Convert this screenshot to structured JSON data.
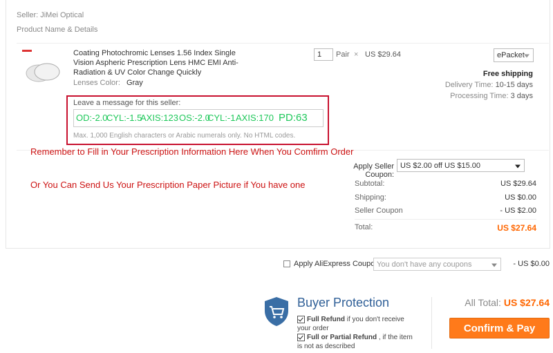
{
  "seller": {
    "label": "Seller: JiMei Optical"
  },
  "section": {
    "product_header": "Product Name & Details"
  },
  "product": {
    "title": "Coating Photochromic Lenses 1.56 Index Single Vision Aspheric Prescription Lens HMC EMI Anti-Radiation & UV Color Change Quickly",
    "lens_color_label": "Lenses Color:",
    "lens_color_value": "Gray",
    "quantity": "1",
    "unit": "Pair",
    "times": "×",
    "price": "US $29.64"
  },
  "shipping": {
    "method": "ePacket",
    "free_label": "Free shipping",
    "delivery_label": "Delivery Time:",
    "delivery_value": "10-15 days",
    "processing_label": "Processing Time:",
    "processing_value": "3 days"
  },
  "message": {
    "label": "Leave a message for this seller:",
    "od": "OD:-2.0",
    "cyl1": "CYL:-1.5",
    "axis1": "AXIS:123",
    "os": "OS:-2.0",
    "cyl2": "CYL:-1",
    "axis2": "AXIS:170",
    "pd": "PD:63",
    "hint": "Max. 1,000 English characters or Arabic numerals only. No HTML codes."
  },
  "notes": {
    "line1": "Remember to Fill in Your Prescription Information Here When You Comfirm Order",
    "line2": "Or You Can Send Us Your Prescription Paper Picture if You have one"
  },
  "coupon": {
    "label": "Apply Seller Coupon:",
    "value": "US $2.00 off US $15.00"
  },
  "summary": {
    "subtotal_label": "Subtotal:",
    "subtotal_value": "US $29.64",
    "shipping_label": "Shipping:",
    "shipping_value": "US $0.00",
    "seller_coupon_label": "Seller Coupon",
    "seller_coupon_value": "- US $2.00",
    "total_label": "Total:",
    "total_value": "US $27.64"
  },
  "aliexpress_coupon": {
    "label": "Apply AliExpress Coupon:",
    "placeholder": "You don't have any coupons",
    "discount": "- US $0.00"
  },
  "buyer_protection": {
    "title": "Buyer Protection",
    "item1_bold": "Full Refund",
    "item1_rest": " if you don't receive your order",
    "item2_bold": "Full or Partial Refund",
    "item2_rest": " , if the item is not as described"
  },
  "checkout": {
    "all_total_label": "All Total:",
    "all_total_value": "US $27.64",
    "confirm_label": "Confirm & Pay"
  },
  "colors": {
    "accent": "#ff7a1a",
    "price": "#ff6600",
    "note_red": "#cc1111",
    "prescription_green": "#1ec85a",
    "shield": "#3a6ea5"
  }
}
